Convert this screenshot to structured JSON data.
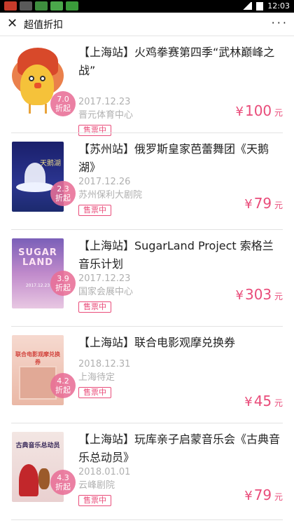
{
  "status_bar": {
    "time": "12:03"
  },
  "navbar": {
    "close_glyph": "✕",
    "title": "超值折扣",
    "more_glyph": "· · ·"
  },
  "colors": {
    "accent": "#e94c7a",
    "badge": "#e86e96",
    "muted": "#b0b0b0"
  },
  "items": [
    {
      "name": "【上海站】火鸡拳赛第四季“武林巅峰之战”",
      "date": "2017.12.23",
      "venue": "晋元体育中心",
      "discount": "7.0",
      "discount_suffix": "折起",
      "tag": "售票中",
      "currency": "¥",
      "price": "100",
      "unit": "元",
      "poster_icon": "turkey-poster"
    },
    {
      "name": "【苏州站】俄罗斯皇家芭蕾舞团《天鹅湖》",
      "date": "2017.12.26",
      "venue": "苏州保利大剧院",
      "discount": "2.3",
      "discount_suffix": "折起",
      "tag": "售票中",
      "currency": "¥",
      "price": "79",
      "unit": "元",
      "poster_icon": "swan-lake-poster",
      "poster_text": "天鹅湖"
    },
    {
      "name": "【上海站】SugarLand Project 索格兰音乐计划",
      "date": "2017.12.23",
      "venue": "国家会展中心",
      "discount": "3.9",
      "discount_suffix": "折起",
      "tag": "售票中",
      "currency": "¥",
      "price": "303",
      "unit": "元",
      "poster_icon": "sugarland-poster",
      "poster_text": "SUGAR LAND",
      "poster_sub": "2017.12.23"
    },
    {
      "name": "【上海站】联合电影观摩兑换券",
      "date": "2018.12.31",
      "venue": "上海待定",
      "discount": "4.2",
      "discount_suffix": "折起",
      "tag": "售票中",
      "currency": "¥",
      "price": "45",
      "unit": "元",
      "poster_icon": "movie-voucher-poster",
      "poster_text": "联合电影观摩兑换券"
    },
    {
      "name": "【上海站】玩库亲子启蒙音乐会《古典音乐总动员》",
      "date": "2018.01.01",
      "venue": "云峰剧院",
      "discount": "4.3",
      "discount_suffix": "折起",
      "tag": "售票中",
      "currency": "¥",
      "price": "79",
      "unit": "元",
      "poster_icon": "kids-concert-poster",
      "poster_text": "古典音乐总动员"
    }
  ]
}
